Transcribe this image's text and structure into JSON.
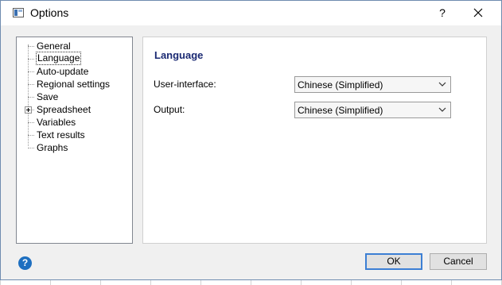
{
  "window": {
    "title": "Options",
    "help_glyph": "?"
  },
  "tree": {
    "items": [
      {
        "label": "General",
        "expandable": false
      },
      {
        "label": "Language",
        "expandable": false,
        "selected": true
      },
      {
        "label": "Auto-update",
        "expandable": false
      },
      {
        "label": "Regional settings",
        "expandable": false
      },
      {
        "label": "Save",
        "expandable": false
      },
      {
        "label": "Spreadsheet",
        "expandable": true
      },
      {
        "label": "Variables",
        "expandable": false
      },
      {
        "label": "Text results",
        "expandable": false
      },
      {
        "label": "Graphs",
        "expandable": false
      }
    ]
  },
  "panel": {
    "heading": "Language",
    "fields": [
      {
        "label": "User-interface:",
        "value": "Chinese (Simplified)"
      },
      {
        "label": "Output:",
        "value": "Chinese (Simplified)"
      }
    ]
  },
  "footer": {
    "help_glyph": "?",
    "ok_label": "OK",
    "cancel_label": "Cancel"
  },
  "colors": {
    "heading": "#1b2a73",
    "help_icon": "#1e6fc0",
    "ok_border": "#3c7fd4"
  }
}
